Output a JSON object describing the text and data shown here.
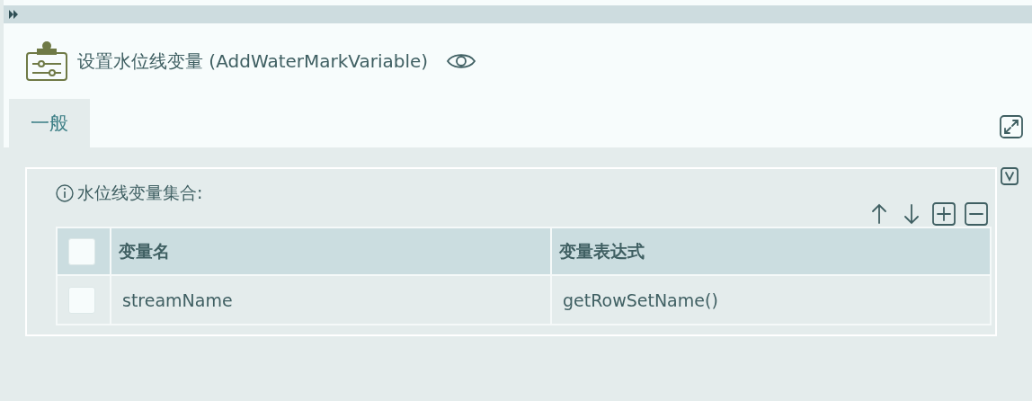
{
  "header": {
    "title": "设置水位线变量 (AddWaterMarkVariable)"
  },
  "tabs": [
    {
      "label": "一般",
      "selected": true
    }
  ],
  "collection": {
    "label": "水位线变量集合:",
    "table": {
      "select_all_checked": false,
      "columns": [
        "变量名",
        "变量表达式"
      ],
      "rows": [
        {
          "checked": false,
          "cells": [
            "streamName",
            "getRowSetName()"
          ]
        }
      ]
    }
  }
}
